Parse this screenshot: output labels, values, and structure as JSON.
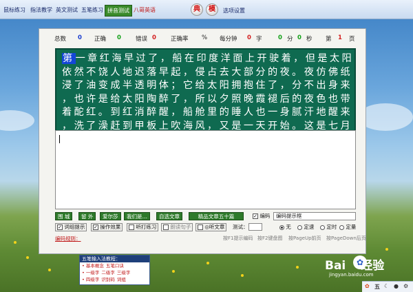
{
  "menubar": {
    "items": [
      {
        "label": "鼠标练习",
        "active": false
      },
      {
        "label": "指法教学",
        "active": false
      },
      {
        "label": "英文测试",
        "active": false
      },
      {
        "label": "五笔练习",
        "active": false
      },
      {
        "label": "拼音测试",
        "active": true
      },
      {
        "label": "八哥英语",
        "active": false,
        "red": true
      }
    ],
    "round_buttons": [
      "典",
      "模"
    ],
    "settings_label": "选项设置"
  },
  "stats": {
    "total_label": "总数",
    "total_value": "0",
    "correct_label": "正确",
    "correct_value": "0",
    "error_label": "错误",
    "error_value": "0",
    "accuracy_label": "正确率",
    "accuracy_unit": "%",
    "speed_label": "每分钟",
    "speed_value": "0",
    "speed_unit": "字",
    "minutes_value": "0",
    "minutes_unit": "分",
    "seconds_value": "0",
    "seconds_unit": "秒",
    "page_prefix": "第",
    "page_value": "1",
    "page_suffix": "页"
  },
  "passage": {
    "cursor_char": "第",
    "line1_rest": "一章红海早过了，船在印度洋面上开驶着，但是太阳",
    "lines": [
      "依然不饶人地迟落早起，侵占去大部分的夜。夜仿佛纸",
      "浸了油变成半透明体；它给太阳拥抱住了，分不出身来",
      "，也许是给太阳陶醉了，所以夕照晚霞褪后的夜色也带",
      "着酡红。到红消醉醒，船舱里的睡人也一身腻汗地醒来",
      "，洗了澡赶到甲板上吹海风，又是一天开始。这是七月"
    ]
  },
  "article_row": {
    "buttons": [
      "围 城",
      "留 外",
      "爱尔莎",
      "我们是…"
    ],
    "custom_article": "自选文章",
    "featured": "精品文章五十篇",
    "code_checkbox_label": "编码",
    "code_checkbox_checked": true,
    "hint_box_text": "编码提示框"
  },
  "option_row": {
    "word_hint": {
      "label": "词组提示",
      "checked": true
    },
    "sound_effect": {
      "label": "操作效果",
      "checked": true
    },
    "listen_practice": {
      "label": "听打练习",
      "checked": false
    },
    "read_sentence": {
      "label": "朗读句子",
      "checked": false
    },
    "listen_article": {
      "label": "◎听文章",
      "checked": false
    },
    "test_label": "测试：",
    "radio_options": [
      {
        "label": "无",
        "selected": true
      },
      {
        "label": "定速",
        "selected": false
      },
      {
        "label": "定时",
        "selected": false
      },
      {
        "label": "定量",
        "selected": false
      }
    ]
  },
  "footer": {
    "rules_link": "编码规则：",
    "hints": [
      "按F1提示编码",
      "按F2键盘图",
      "按PageUp前页",
      "按PageDown后页"
    ]
  },
  "tutorial": {
    "title": "五笔输入法教程：",
    "rows": [
      [
        "• 基本概念",
        "五笔口诀"
      ],
      [
        "• 一级字",
        "二级字",
        "三级字"
      ],
      [
        "• 四级字",
        "识别码",
        "词组"
      ]
    ]
  },
  "watermark": {
    "brand": "Bai",
    "brand2": "经验",
    "url": "jingyan.baidu.com"
  },
  "tray": {
    "items": [
      "五",
      "☾",
      "●",
      "⚙"
    ]
  },
  "colors": {
    "passage_bg": "#0f6a50",
    "menu_active": "#3a8a2a",
    "accent_red": "#d42020",
    "accent_blue": "#1a3ecf"
  }
}
